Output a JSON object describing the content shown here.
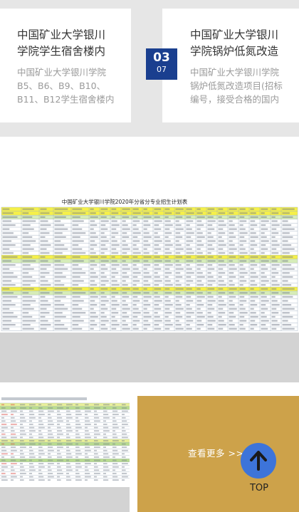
{
  "news": [
    {
      "title": "中国矿业大学银川\n学院学生宿舍楼内",
      "summary": "中国矿业大学银川学院\nB5、B6、B9、B10、\nB11、B12学生宿舍楼内"
    },
    {
      "day": "03",
      "month": "07",
      "title": "中国矿业大学银川\n学院锅炉低氮改造",
      "summary": "中国矿业大学银川学院\n锅炉低氮改造项目(招标\n编号，接受合格的国内"
    }
  ],
  "plan": {
    "title": "中国矿业大学银川学院2020年分省分专业招生计划表"
  },
  "more": {
    "label": "查看更多 >>"
  },
  "top": {
    "label": "TOP"
  },
  "colors": {
    "date_blue": "#1a3f8f",
    "gold": "#cda24a",
    "top_blue": "#3d74d9",
    "highlight_yellow": "#f5f04a"
  }
}
